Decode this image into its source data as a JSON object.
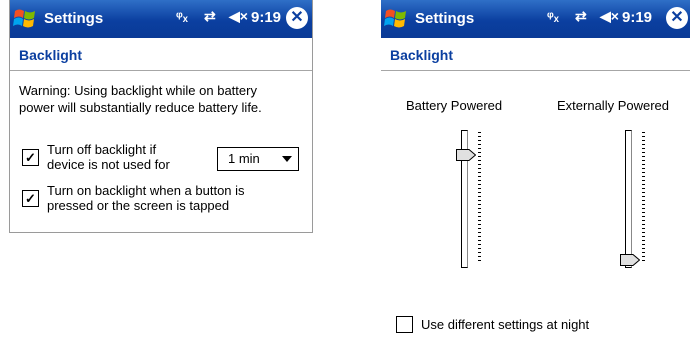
{
  "colors": {
    "titlebar": "#0b3fa0",
    "accent": "#0b3fa0",
    "border": "#a6a6a6"
  },
  "left_screen": {
    "title": "Settings",
    "status": {
      "connectivity_icon": "antenna-x-icon",
      "sync_icon": "sync-arrows-icon",
      "volume_icon": "speaker-muted-icon",
      "time": "9:19"
    },
    "close_icon": "close-icon",
    "subheader": "Backlight",
    "warning_line1": "Warning: Using backlight while on battery",
    "warning_line2": "power will substantially reduce battery life.",
    "option1": {
      "checked": true,
      "line1": "Turn off backlight if",
      "line2": "device is not used for"
    },
    "timeout_select": {
      "value": "1 min"
    },
    "option2": {
      "checked": true,
      "line1": "Turn on backlight when a button is",
      "line2": "pressed or the screen is tapped"
    }
  },
  "right_screen": {
    "title": "Settings",
    "status": {
      "connectivity_icon": "antenna-x-icon",
      "sync_icon": "sync-arrows-icon",
      "volume_icon": "speaker-muted-icon",
      "time": "9:19"
    },
    "subheader": "Backlight",
    "battery_slider": {
      "label": "Battery Powered",
      "level": 0.85
    },
    "external_slider": {
      "label": "Externally Powered",
      "level": 0.0
    },
    "night_option": {
      "checked": false,
      "label": "Use different settings at night"
    }
  }
}
